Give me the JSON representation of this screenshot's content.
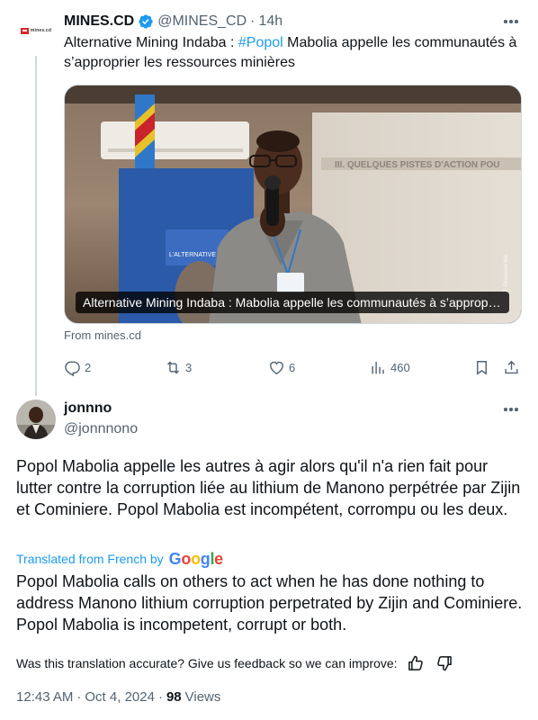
{
  "tweet": {
    "logo_text": "mines.cd",
    "author_name": "MINES.CD",
    "author_handle": "@MINES_CD",
    "separator": "·",
    "time": "14h",
    "text_prefix": "Alternative Mining Indaba : ",
    "hashtag": "#Popol",
    "text_suffix": " Mabolia appelle les communautés à s’approprier les ressources minières",
    "media_caption": "Alternative Mining Indaba : Mabolia appelle les communautés à s’approprier les ressources minières",
    "slide_text": "III. QUELQUES PISTES D'ACTION POU",
    "banner_text": "L'ALTERNATIVE MINING INDABA",
    "watermark": "© Resource Ma",
    "source": "From mines.cd",
    "actions": {
      "replies": "2",
      "reposts": "3",
      "likes": "6",
      "views": "460"
    }
  },
  "reply": {
    "author_name": "jonnno",
    "author_handle": "@jonnnono",
    "text": "Popol Mabolia appelle les autres à agir alors qu'il n'a rien fait pour lutter contre la corruption liée au lithium de Manono perpétrée par Zijin et Cominiere. Popol Mabolia est incompétent, corrompu ou les deux.",
    "translated_label": "Translated from French by",
    "google": [
      "G",
      "o",
      "o",
      "g",
      "l",
      "e"
    ],
    "translation": "Popol Mabolia calls on others to act when he has done nothing to address Manono lithium corruption perpetrated by Zijin and Cominiere. Popol Mabolia is incompetent, corrupt or both.",
    "feedback_question": "Was this translation accurate? Give us feedback so we can improve:",
    "timestamp": "12:43 AM",
    "date": "Oct 4, 2024",
    "views_count": "98",
    "views_label": "Views"
  },
  "colors": {
    "accent": "#1d9bf0",
    "text_primary": "#0f1419",
    "text_secondary": "#536471",
    "divider": "#cfd9de",
    "logo_red": "#d7262b"
  },
  "icons": [
    "verified-badge-icon",
    "more-icon",
    "reply-icon",
    "repost-icon",
    "like-icon",
    "views-icon",
    "bookmark-icon",
    "share-icon",
    "thumbs-up-icon",
    "thumbs-down-icon"
  ]
}
